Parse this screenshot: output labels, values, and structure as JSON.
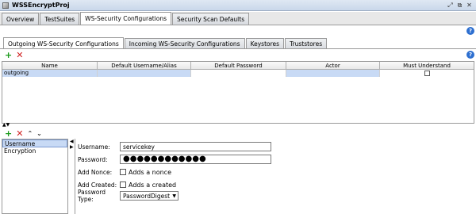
{
  "window": {
    "title": "WSSEncryptProj"
  },
  "main_tabs": [
    "Overview",
    "TestSuites",
    "WS-Security Configurations",
    "Security Scan Defaults"
  ],
  "sub_tabs": [
    "Outgoing WS-Security Configurations",
    "Incoming WS-Security Configurations",
    "Keystores",
    "Truststores"
  ],
  "help_icon": "?",
  "table": {
    "columns": [
      "Name",
      "Default Username/Alias",
      "Default Password",
      "Actor",
      "Must Understand"
    ],
    "rows": [
      {
        "name": "outgoing",
        "username": "",
        "password": "",
        "actor": "",
        "must_understand": false
      }
    ]
  },
  "entries": [
    "Username",
    "Encryption"
  ],
  "form": {
    "username_label": "Username:",
    "username_value": "servicekey",
    "password_label": "Password:",
    "password_value": "●●●●●●●●●●●●",
    "add_nonce_label": "Add Nonce:",
    "add_nonce_text": "Adds a nonce",
    "add_created_label": "Add Created:",
    "add_created_text": "Adds a created",
    "password_type_label": "Password Type:",
    "password_type_value": "PasswordDigest"
  },
  "colors": {
    "selection": "#c8daf5",
    "add_icon": "#1a9a1a",
    "remove_icon": "#d02020",
    "help_icon": "#2d6fd0"
  }
}
